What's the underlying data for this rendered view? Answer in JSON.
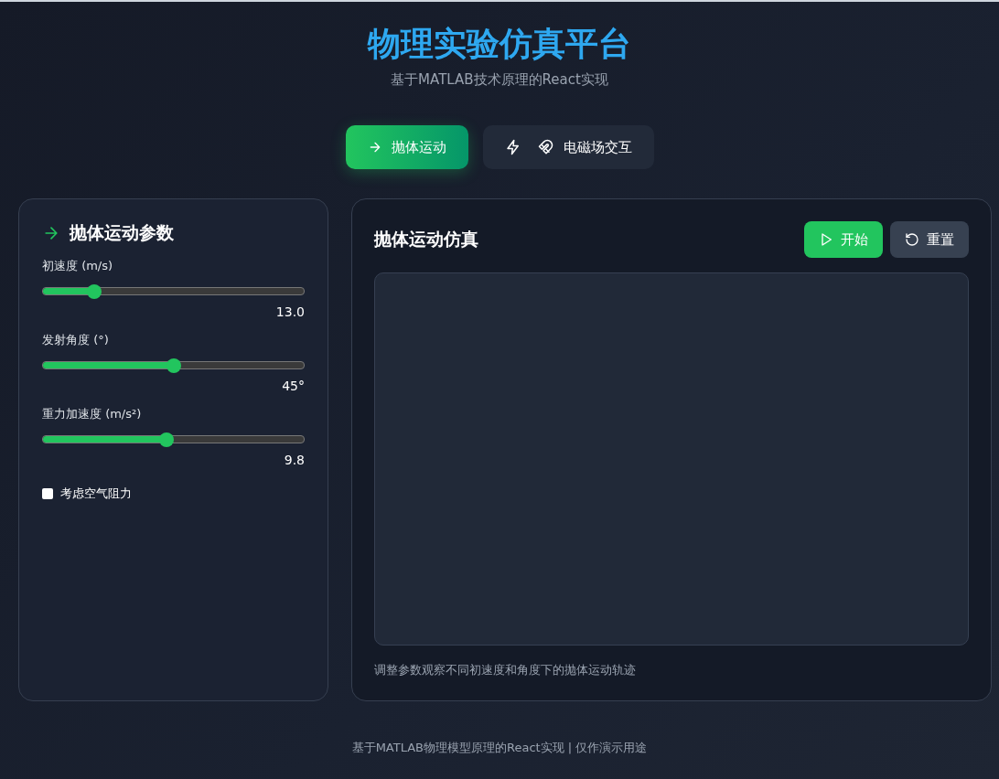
{
  "header": {
    "title": "物理实验仿真平台",
    "subtitle": "基于MATLAB技术原理的React实现"
  },
  "tabs": [
    {
      "kind": "projectile",
      "label": "抛体运动",
      "selected": true
    },
    {
      "kind": "electromagnetic",
      "label": "电磁场交互",
      "selected": false
    }
  ],
  "params_panel": {
    "title": "抛体运动参数",
    "sliders": [
      {
        "label": "初速度 (m/s)",
        "level": 0.195,
        "reading": "13.0"
      },
      {
        "label": "发射角度 (°)",
        "level": 0.5,
        "reading": "45°"
      },
      {
        "label": "重力加速度 (m/s²)",
        "level": 0.474,
        "reading": "9.8"
      }
    ],
    "checkbox": {
      "label": "考虑空气阻力",
      "checked": false
    }
  },
  "sim_panel": {
    "title": "抛体运动仿真",
    "buttons": [
      {
        "kind": "start",
        "label": "开始"
      },
      {
        "kind": "reset",
        "label": "重置"
      }
    ],
    "caption": "调整参数观察不同初速度和角度下的抛体运动轨迹"
  },
  "footer": "基于MATLAB物理模型原理的React实现 | 仅作演示用途"
}
